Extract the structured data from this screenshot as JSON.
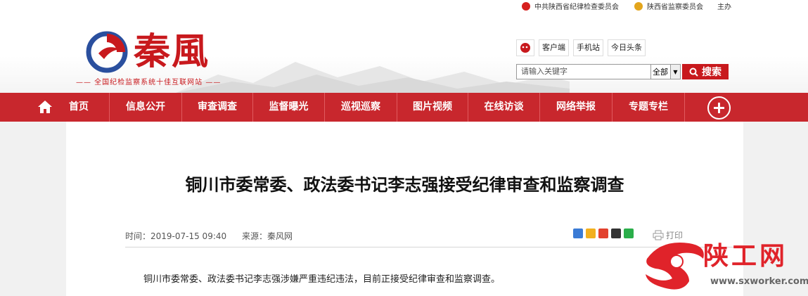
{
  "topbar": {
    "links": [
      "中共陕西省纪律检查委员会",
      "陕西省监察委员会",
      "主办"
    ]
  },
  "brand": {
    "logo_text": "秦風",
    "slogan": "—— 全国纪检监察系统十佳互联网站 ——"
  },
  "client_bar": {
    "buttons": [
      "客户端",
      "手机站",
      "今日头条"
    ]
  },
  "search": {
    "placeholder": "请输入关键字",
    "scope_selected": "全部",
    "button_label": "搜索"
  },
  "nav": {
    "items": [
      "首页",
      "信息公开",
      "审查调查",
      "监督曝光",
      "巡视巡察",
      "图片视频",
      "在线访谈",
      "网络举报",
      "专题专栏"
    ]
  },
  "article": {
    "title": "铜川市委常委、政法委书记李志强接受纪律审查和监察调查",
    "time_label": "时间：2019-07-15 09:40",
    "source_label": "来源：秦风网",
    "print_label": "打印",
    "body": "铜川市委常委、政法委书记李志强涉嫌严重违纪违法，目前正接受纪律审查和监察调查。"
  },
  "watermark": {
    "text": "陕工网",
    "url": "www.sxworker.com"
  },
  "colors": {
    "brand_red": "#c8191d",
    "nav_red": "#c8272d"
  }
}
